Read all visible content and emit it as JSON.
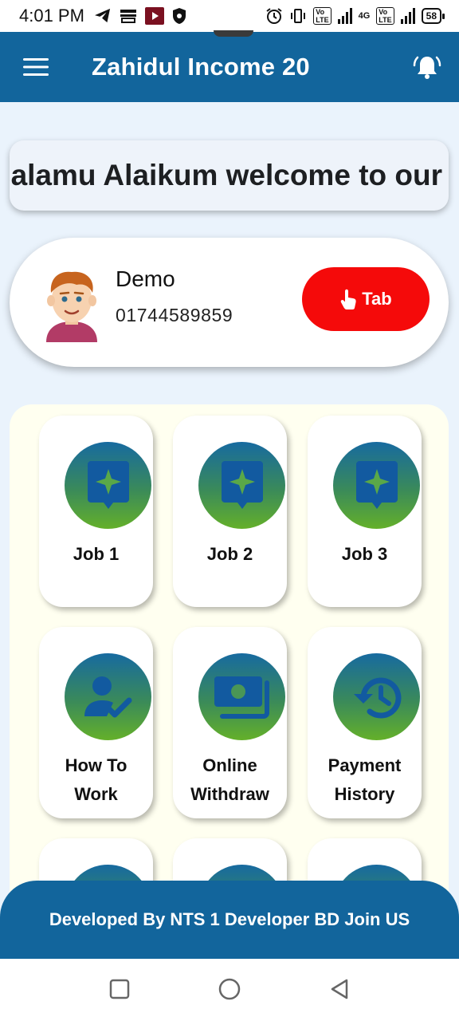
{
  "status_bar": {
    "time": "4:01 PM",
    "battery": "58",
    "network": "4G"
  },
  "app_bar": {
    "title": "Zahidul Income 20",
    "menu_icon": "hamburger-menu-icon",
    "notification_icon": "bell-icon"
  },
  "marquee": {
    "text": "Assalamu Alaikum welcome to our"
  },
  "user": {
    "name": "Demo",
    "phone": "01744589859",
    "tab_button_label": "Tab",
    "tab_button_icon": "tap-hand-icon"
  },
  "tiles": [
    {
      "label": "Job 1",
      "icon": "sparkle-message-icon"
    },
    {
      "label": "Job 2",
      "icon": "sparkle-message-icon"
    },
    {
      "label": "Job 3",
      "icon": "sparkle-message-icon"
    },
    {
      "label_lines": [
        "How To",
        "Work"
      ],
      "icon": "person-check-icon"
    },
    {
      "label_lines": [
        "Online",
        "Withdraw"
      ],
      "icon": "money-icon"
    },
    {
      "label_lines": [
        "Payment",
        "History"
      ],
      "icon": "history-icon"
    }
  ],
  "footer": {
    "text": "Developed By NTS 1 Developer BD Join US"
  },
  "colors": {
    "primary": "#12659c",
    "accent_red": "#f50a0a",
    "panel_bg": "#fffff0",
    "content_bg": "#eaf3fc"
  }
}
